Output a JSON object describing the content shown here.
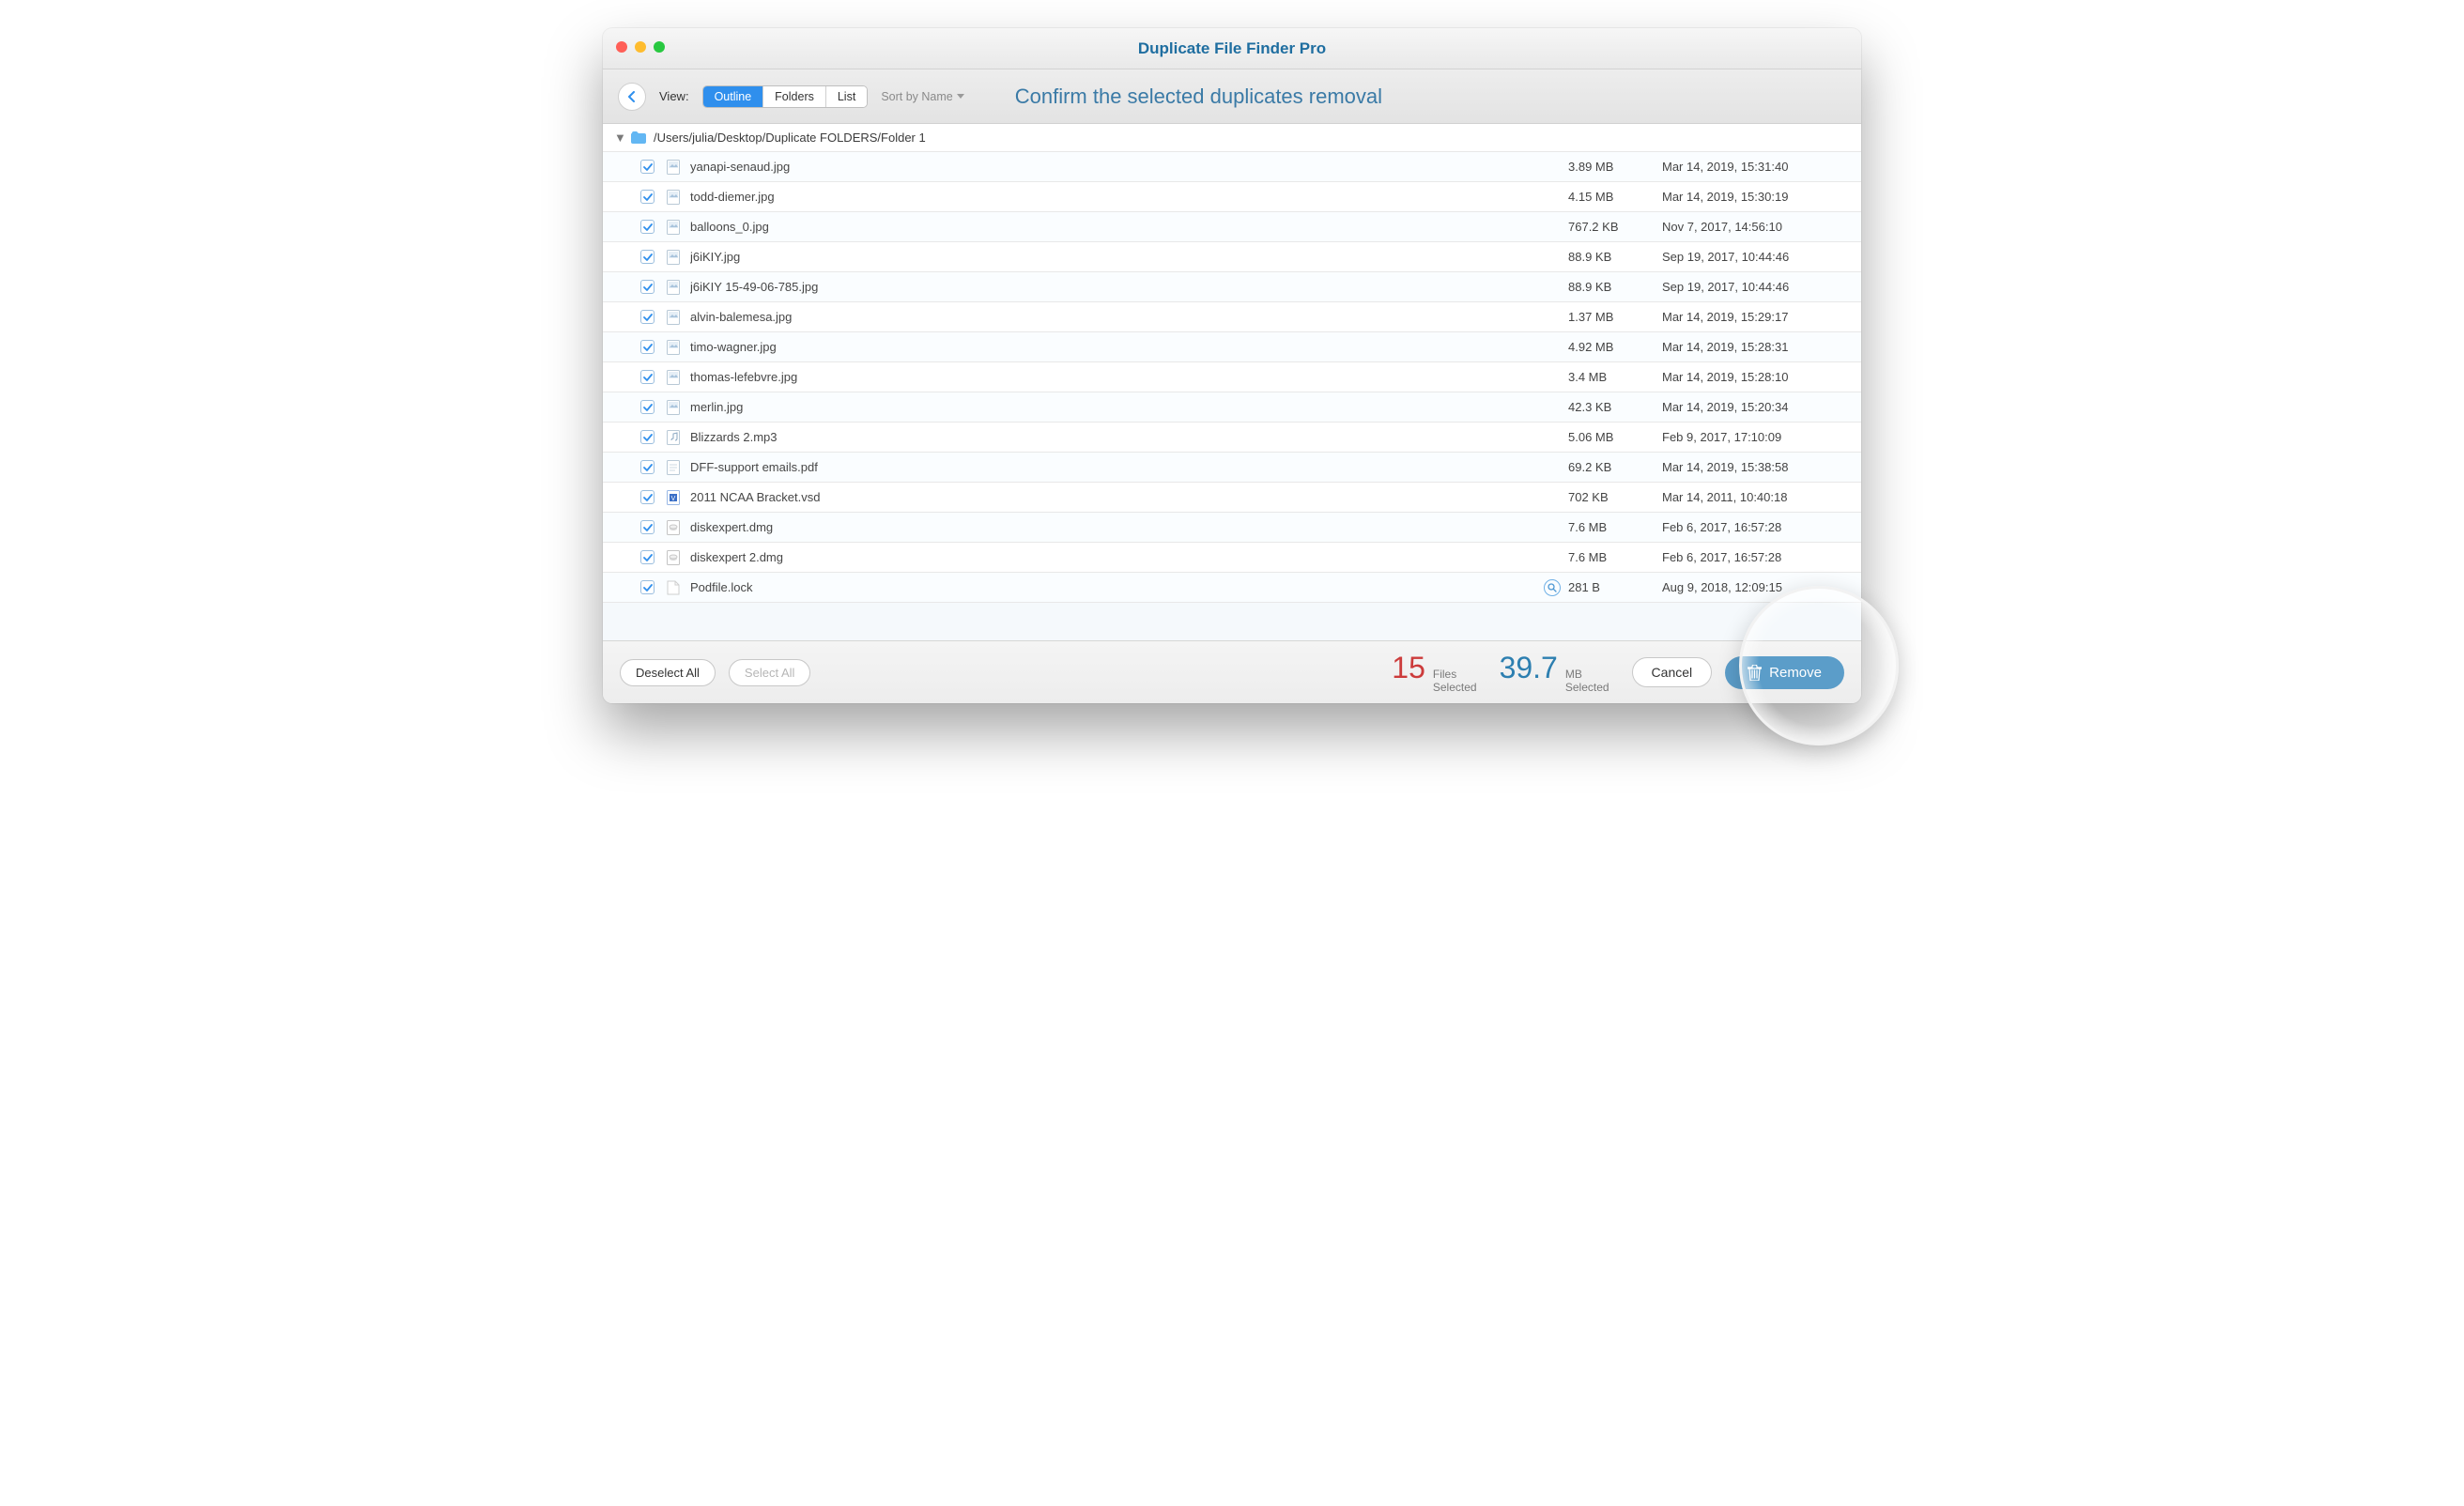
{
  "app_title": "Duplicate File Finder Pro",
  "toolbar": {
    "view_label": "View:",
    "segments": [
      "Outline",
      "Folders",
      "List"
    ],
    "segment_active_index": 0,
    "sort_label": "Sort by Name",
    "banner": "Confirm the selected duplicates removal"
  },
  "folder": {
    "path": "/Users/julia/Desktop/Duplicate FOLDERS/Folder 1"
  },
  "rows": [
    {
      "checked": true,
      "icon": "image",
      "name": "yanapi-senaud.jpg",
      "size": "3.89 MB",
      "date": "Mar 14, 2019, 15:31:40"
    },
    {
      "checked": true,
      "icon": "image",
      "name": "todd-diemer.jpg",
      "size": "4.15 MB",
      "date": "Mar 14, 2019, 15:30:19"
    },
    {
      "checked": true,
      "icon": "image",
      "name": "balloons_0.jpg",
      "size": "767.2 KB",
      "date": "Nov 7, 2017, 14:56:10"
    },
    {
      "checked": true,
      "icon": "image",
      "name": "j6iKIY.jpg",
      "size": "88.9 KB",
      "date": "Sep 19, 2017, 10:44:46"
    },
    {
      "checked": true,
      "icon": "image",
      "name": "j6iKIY 15-49-06-785.jpg",
      "size": "88.9 KB",
      "date": "Sep 19, 2017, 10:44:46"
    },
    {
      "checked": true,
      "icon": "image",
      "name": "alvin-balemesa.jpg",
      "size": "1.37 MB",
      "date": "Mar 14, 2019, 15:29:17"
    },
    {
      "checked": true,
      "icon": "image",
      "name": "timo-wagner.jpg",
      "size": "4.92 MB",
      "date": "Mar 14, 2019, 15:28:31"
    },
    {
      "checked": true,
      "icon": "image",
      "name": "thomas-lefebvre.jpg",
      "size": "3.4 MB",
      "date": "Mar 14, 2019, 15:28:10"
    },
    {
      "checked": true,
      "icon": "image",
      "name": "merlin.jpg",
      "size": "42.3 KB",
      "date": "Mar 14, 2019, 15:20:34"
    },
    {
      "checked": true,
      "icon": "audio",
      "name": "Blizzards 2.mp3",
      "size": "5.06 MB",
      "date": "Feb 9, 2017, 17:10:09"
    },
    {
      "checked": true,
      "icon": "doc",
      "name": "DFF-support emails.pdf",
      "size": "69.2 KB",
      "date": "Mar 14, 2019, 15:38:58"
    },
    {
      "checked": true,
      "icon": "visio",
      "name": "2011 NCAA Bracket.vsd",
      "size": "702 KB",
      "date": "Mar 14, 2011, 10:40:18"
    },
    {
      "checked": true,
      "icon": "dmg",
      "name": "diskexpert.dmg",
      "size": "7.6 MB",
      "date": "Feb 6, 2017, 16:57:28"
    },
    {
      "checked": true,
      "icon": "dmg",
      "name": "diskexpert 2.dmg",
      "size": "7.6 MB",
      "date": "Feb 6, 2017, 16:57:28"
    },
    {
      "checked": true,
      "icon": "blank",
      "name": "Podfile.lock",
      "size": "281 B",
      "date": "Aug 9, 2018, 12:09:15",
      "magnify": true
    }
  ],
  "footer": {
    "deselect_label": "Deselect All",
    "select_label": "Select All",
    "files_count": "15",
    "files_unit_a": "Files",
    "files_unit_b": "Selected",
    "size_total": "39.7",
    "size_unit_a": "MB",
    "size_unit_b": "Selected",
    "cancel_label": "Cancel",
    "remove_label": "Remove"
  }
}
